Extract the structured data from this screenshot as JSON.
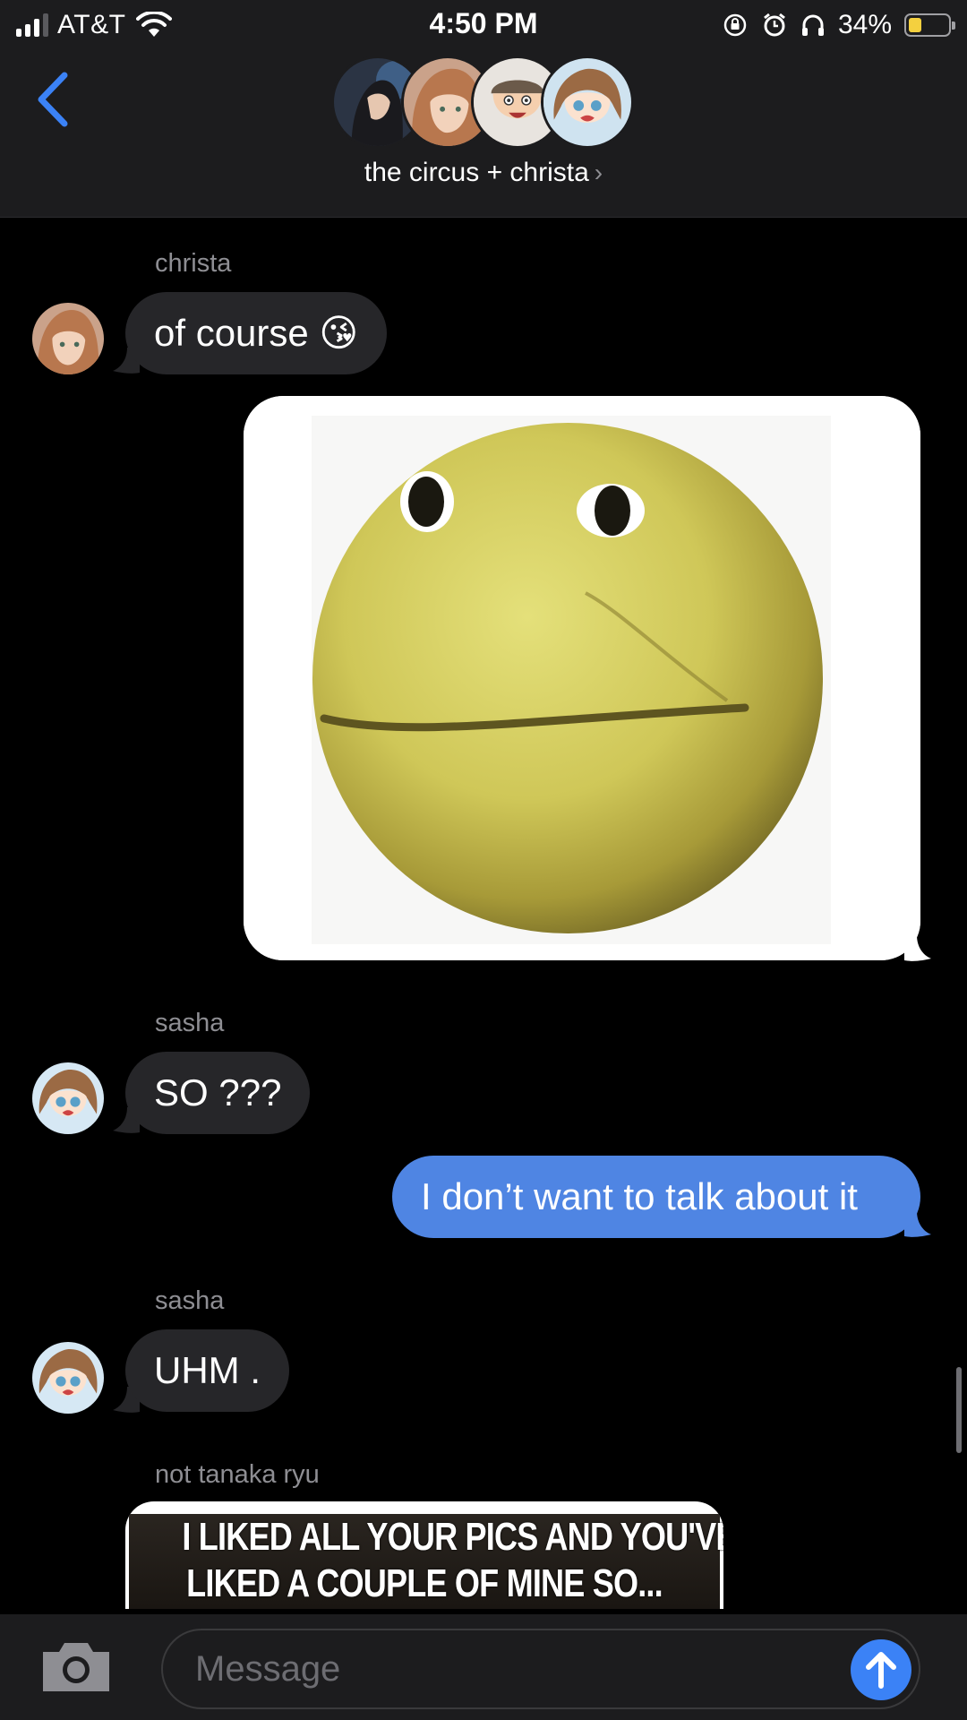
{
  "status_bar": {
    "carrier": "AT&T",
    "time": "4:50 PM",
    "battery_percent": "34%",
    "battery_level": 0.34,
    "icons": [
      "signal-icon",
      "wifi-icon",
      "rotation-lock-icon",
      "alarm-icon",
      "headphones-icon",
      "battery-icon"
    ]
  },
  "header": {
    "group_name": "the circus + christa",
    "chevron": "›",
    "participants_avatars": [
      "avatar-1",
      "avatar-2",
      "avatar-3",
      "avatar-4"
    ]
  },
  "messages": [
    {
      "sender": "christa",
      "direction": "incoming",
      "text": "of course 😘"
    },
    {
      "sender": "",
      "direction": "outgoing",
      "type": "image",
      "description_icon": "yellow-smiley-ball"
    },
    {
      "sender": "sasha",
      "direction": "incoming",
      "text": "SO ???"
    },
    {
      "sender": "",
      "direction": "outgoing",
      "text": "I don’t want to talk about it"
    },
    {
      "sender": "sasha",
      "direction": "incoming",
      "text": "UHM ."
    },
    {
      "sender": "not tanaka ryu",
      "direction": "incoming",
      "type": "image",
      "image_text_line1": "I LIKED ALL YOUR PICS AND YOU'VE",
      "image_text_line2": "LIKED A COUPLE OF MINE SO..."
    }
  ],
  "composer": {
    "placeholder": "Message"
  },
  "colors": {
    "outgoing_bubble": "#4f85e3",
    "incoming_bubble": "#262629",
    "accent": "#3b82f6",
    "background": "#000000"
  }
}
